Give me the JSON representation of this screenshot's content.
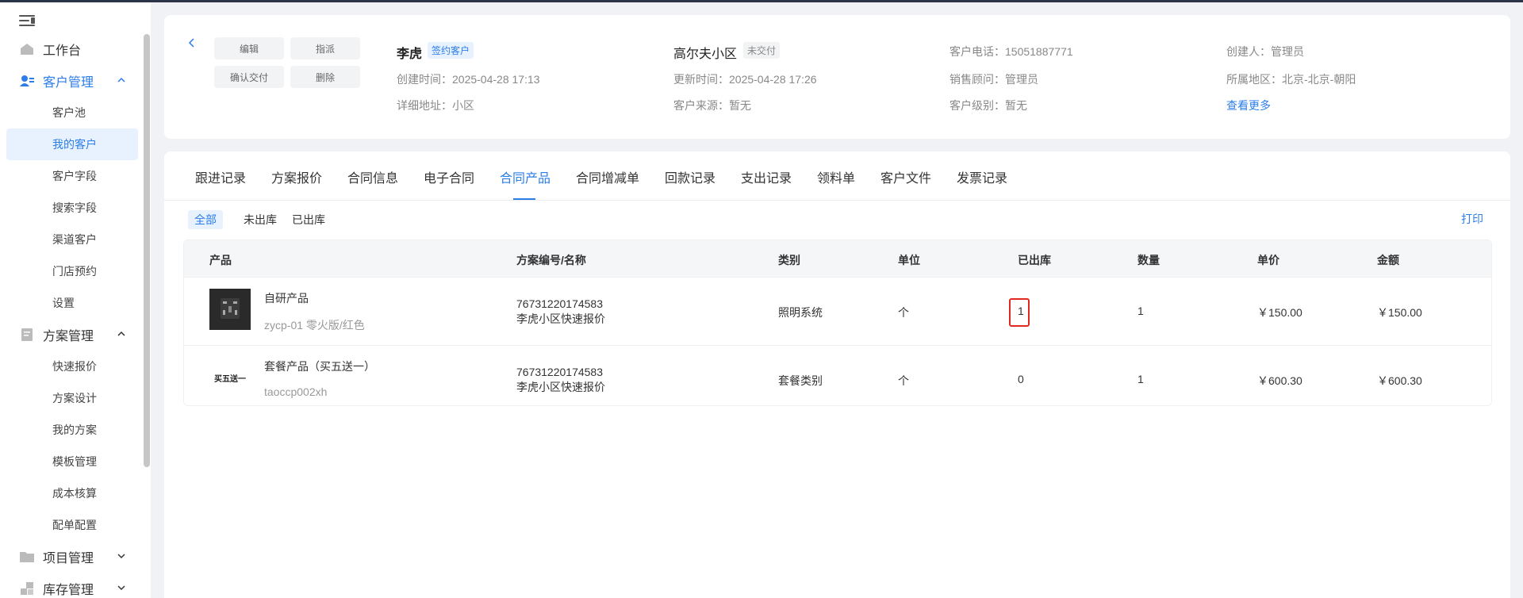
{
  "sidebar": {
    "items": [
      {
        "label": "工作台"
      },
      {
        "label": "客户管理"
      },
      {
        "label": "客户池"
      },
      {
        "label": "我的客户"
      },
      {
        "label": "客户字段"
      },
      {
        "label": "搜索字段"
      },
      {
        "label": "渠道客户"
      },
      {
        "label": "门店预约"
      },
      {
        "label": "设置"
      },
      {
        "label": "方案管理"
      },
      {
        "label": "快速报价"
      },
      {
        "label": "方案设计"
      },
      {
        "label": "我的方案"
      },
      {
        "label": "模板管理"
      },
      {
        "label": "成本核算"
      },
      {
        "label": "配单配置"
      },
      {
        "label": "项目管理"
      },
      {
        "label": "库存管理"
      }
    ]
  },
  "header": {
    "buttons": {
      "edit": "编辑",
      "assign": "指派",
      "confirm_delivery": "确认交付",
      "delete": "删除"
    },
    "customer_name": "李虎",
    "customer_tag": "签约客户",
    "community": "高尔夫小区",
    "delivery_tag": "未交付",
    "created_time": "创建时间：2025-04-28 17:13",
    "updated_time": "更新时间：2025-04-28 17:26",
    "address": "详细地址：小区",
    "source": "客户来源：暂无",
    "phone": "客户电话：15051887771",
    "consultant": "销售顾问：管理员",
    "level": "客户级别：暂无",
    "creator": "创建人：管理员",
    "region": "所属地区：北京-北京-朝阳",
    "more": "查看更多"
  },
  "tabs": [
    "跟进记录",
    "方案报价",
    "合同信息",
    "电子合同",
    "合同产品",
    "合同增减单",
    "回款记录",
    "支出记录",
    "领料单",
    "客户文件",
    "发票记录"
  ],
  "active_tab": "合同产品",
  "filters": [
    "全部",
    "未出库",
    "已出库"
  ],
  "print": "打印",
  "table": {
    "headers": [
      "产品",
      "方案编号/名称",
      "类别",
      "单位",
      "已出库",
      "数量",
      "单价",
      "金额"
    ],
    "rows": [
      {
        "name": "自研产品",
        "spec": "zycp-01 零火版/红色",
        "plan_no": "76731220174583",
        "plan_name": "李虎小区快速报价",
        "category": "照明系统",
        "unit": "个",
        "shipped": "1",
        "qty": "1",
        "price": "￥150.00",
        "amount": "￥150.00"
      },
      {
        "name": "套餐产品（买五送一）",
        "spec": "taoccp002xh",
        "thumb_text": "买五送一",
        "plan_no": "76731220174583",
        "plan_name": "李虎小区快速报价",
        "category": "套餐类别",
        "unit": "个",
        "shipped": "0",
        "qty": "1",
        "price": "￥600.30",
        "amount": "￥600.30"
      }
    ]
  }
}
